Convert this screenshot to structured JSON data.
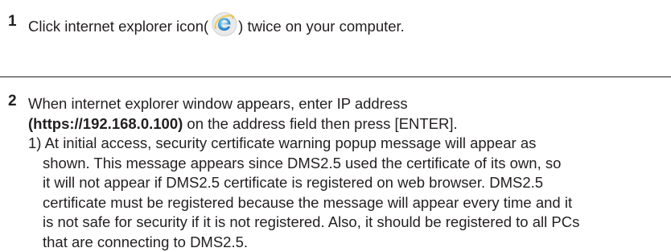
{
  "steps": [
    {
      "number": "1",
      "text_before_icon": "Click internet explorer icon(",
      "icon": "internet-explorer-icon",
      "text_after_icon": ") twice on your computer."
    },
    {
      "number": "2",
      "line1": "When internet explorer window appears, enter IP address",
      "address": "(https://192.168.0.100)",
      "line2_rest": " on the address field then press [ENTER].",
      "sub_items": [
        {
          "lines": [
            "1) At initial access, security certificate warning popup message will appear as",
            "shown. This message appears since DMS2.5 used the certificate of its own, so",
            "it will not appear if DMS2.5 certificate is registered on web browser. DMS2.5",
            "certificate must be registered because the message will appear every time and it",
            "is not safe for security if it is not registered. Also, it should be registered to all PCs",
            "that are connecting to DMS2.5."
          ]
        }
      ]
    }
  ],
  "colors": {
    "text": "#231f20",
    "icon_blue": "#3aa0dc",
    "icon_ring": "#f0c419"
  }
}
